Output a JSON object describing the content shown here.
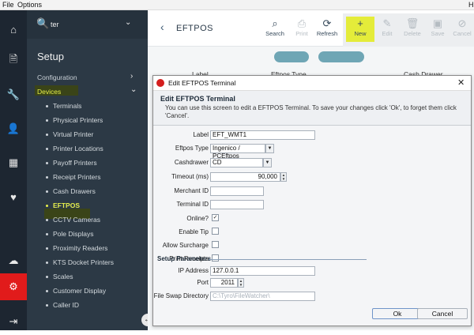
{
  "menubar": {
    "file": "File",
    "options": "Options",
    "right_glyph": "H"
  },
  "rail": {
    "icons": [
      "home-icon",
      "report-icon",
      "wrench-icon",
      "person-icon",
      "chart-icon",
      "heart-icon",
      "cloud-upload-icon",
      "gear-icon",
      "logout-icon"
    ],
    "glyphs": [
      "⌂",
      "🗎",
      "🔧",
      "👤",
      "▦",
      "♥",
      "☁",
      "⚙",
      "⇥"
    ]
  },
  "sidebar": {
    "search_value": "ter",
    "title": "Setup",
    "categories": [
      {
        "label": "Configuration"
      },
      {
        "label": "Devices"
      }
    ],
    "items": [
      "Terminals",
      "Physical Printers",
      "Virtual Printer",
      "Printer Locations",
      "Payoff Printers",
      "Receipt Printers",
      "Cash Drawers",
      "EFTPOS",
      "CCTV Cameras",
      "Pole Displays",
      "Proximity Readers",
      "KTS Docket Printers",
      "Scales",
      "Customer Display",
      "Caller ID"
    ],
    "selected_item": "EFTPOS",
    "splitter_glyph": "↔"
  },
  "header": {
    "title": "EFTPOS",
    "toolbar": {
      "search": "Search",
      "print": "Print",
      "refresh": "Refresh",
      "new": "New",
      "edit": "Edit",
      "delete": "Delete",
      "save": "Save",
      "cancel": "Cancel"
    }
  },
  "grid": {
    "columns": [
      "Label",
      "Eftpos Type",
      "Cash Drawer"
    ]
  },
  "dialog": {
    "window_title": "Edit EFTPOS Terminal",
    "heading": "Edit EFTPOS Terminal",
    "description": "You can use this screen to edit a EFTPOS Terminal. To save your changes click 'Ok', to forget them click 'Cancel'.",
    "fields": {
      "label": {
        "label": "Label",
        "value": "EFT_WMT1"
      },
      "eftpos_type": {
        "label": "Eftpos Type",
        "value": "Ingenico / PCEftpos"
      },
      "cashdrawer": {
        "label": "Cashdrawer",
        "value": "CD"
      },
      "timeout": {
        "label": "Timeout (ms)",
        "value": "90,000"
      },
      "merchant_id": {
        "label": "Merchant ID",
        "value": ""
      },
      "terminal_id": {
        "label": "Terminal ID",
        "value": ""
      },
      "online": {
        "label": "Online?",
        "checked": true
      },
      "enable_tip": {
        "label": "Enable Tip",
        "checked": false
      },
      "allow_surcharge": {
        "label": "Allow Surcharge",
        "checked": false
      },
      "print_receipts": {
        "label": "Print Receipts",
        "checked": false
      },
      "ip_address": {
        "label": "IP Address",
        "value": "127.0.0.1"
      },
      "port": {
        "label": "Port",
        "value": "2011"
      },
      "file_swap_directory": {
        "label": "File Swap Directory",
        "value": "C:\\Tyro\\FileWatcher\\"
      }
    },
    "section_setup_parameters": "Setup Parameters",
    "ok_label": "Ok",
    "cancel_label": "Cancel"
  }
}
